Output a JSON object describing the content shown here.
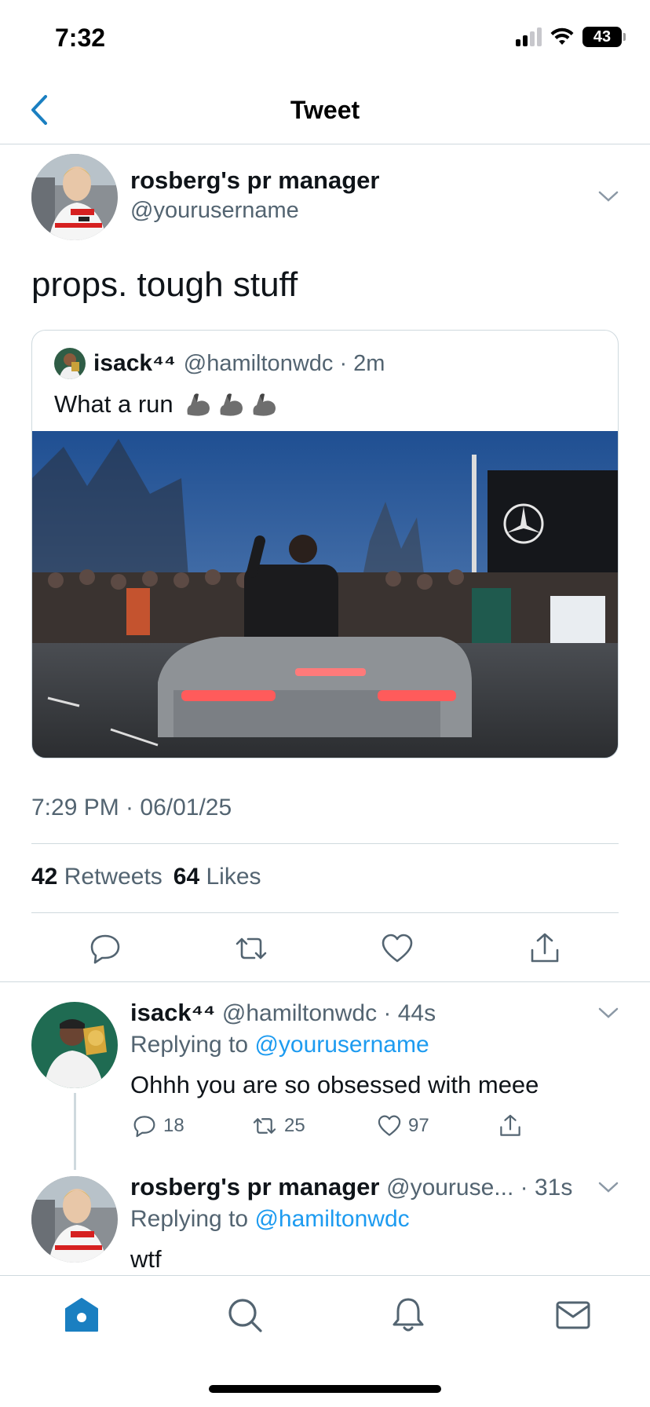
{
  "status_bar": {
    "time": "7:32",
    "battery": "43"
  },
  "header": {
    "title": "Tweet"
  },
  "main_tweet": {
    "author_name": "rosberg's pr manager",
    "author_handle": "@yourusername",
    "text": "props. tough stuff",
    "timestamp": "7:29 PM · 06/01/25",
    "retweets_count": "42",
    "retweets_label": "Retweets",
    "likes_count": "64",
    "likes_label": "Likes"
  },
  "quoted_tweet": {
    "author_name": "isack⁴⁴",
    "author_handle": "@hamiltonwdc · 2m",
    "text": "What a run"
  },
  "replies": [
    {
      "author_name": "isack⁴⁴",
      "meta": "@hamiltonwdc · 44s",
      "replying_prefix": "Replying to ",
      "replying_to": "@yourusername",
      "text": "Ohhh you are so obsessed with meee",
      "reply_count": "18",
      "retweet_count": "25",
      "like_count": "97"
    },
    {
      "author_name": "rosberg's pr manager",
      "meta": "@youruse... · 31s",
      "replying_prefix": "Replying to ",
      "replying_to": "@hamiltonwdc",
      "text": "wtf"
    }
  ],
  "colors": {
    "accent": "#1d9bf0",
    "nav_active": "#1a7fc1",
    "secondary_text": "#536471"
  },
  "tabbar": [
    "home-icon",
    "search-icon",
    "bell-icon",
    "mail-icon"
  ]
}
